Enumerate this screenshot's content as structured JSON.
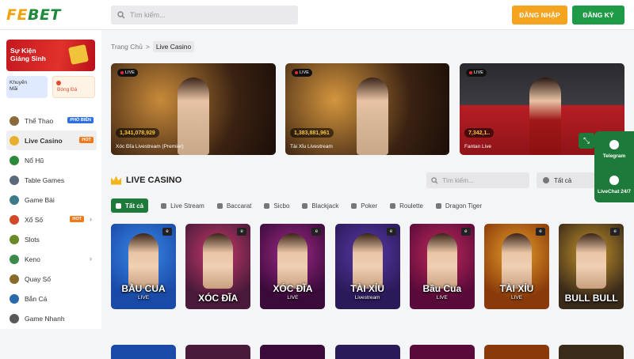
{
  "header": {
    "logo_fe": "FE",
    "logo_bet": "BET",
    "search_placeholder": "Tìm kiếm...",
    "login_label": "ĐĂNG NHẬP",
    "register_label": "ĐĂNG KÝ"
  },
  "sidebar": {
    "promo_event": "Sự Kiện\nGiáng Sinh",
    "promo_bonus": "Khuyến\nMãi",
    "promo_football": "Bóng Đá",
    "items": [
      {
        "label": "Thể Thao",
        "badge": "PHỔ BIẾN",
        "badge_color": "#2f6fe0",
        "icon_color": "#8a6a3a"
      },
      {
        "label": "Live Casino",
        "badge": "HOT",
        "badge_color": "#f07a1a",
        "icon_color": "#e8b02a"
      },
      {
        "label": "Nổ Hũ",
        "badge": "",
        "icon_color": "#2a8a3a"
      },
      {
        "label": "Table Games",
        "badge": "",
        "icon_color": "#5a6a7a"
      },
      {
        "label": "Game Bài",
        "badge": "",
        "icon_color": "#3a7a8a"
      },
      {
        "label": "Xổ Số",
        "badge": "HOT",
        "badge_color": "#f07a1a",
        "icon_color": "#d04a2a",
        "chevron": "›"
      },
      {
        "label": "Slots",
        "badge": "",
        "icon_color": "#6a8a2a"
      },
      {
        "label": "Keno",
        "badge": "",
        "icon_color": "#3a8a4a",
        "chevron": "›"
      },
      {
        "label": "Quay Số",
        "badge": "",
        "icon_color": "#8a6a2a"
      },
      {
        "label": "Bắn Cá",
        "badge": "",
        "icon_color": "#2a6aaa"
      },
      {
        "label": "Game Nhanh",
        "badge": "",
        "icon_color": "#5a5a5a"
      }
    ]
  },
  "breadcrumb": {
    "home": "Trang Chủ",
    "separator": ">",
    "current": "Live Casino"
  },
  "featured": [
    {
      "title": "Xóc Đĩa Livestream (Premier)",
      "amount": "1,341,078,929",
      "live": "LIVE"
    },
    {
      "title": "Tài Xỉu Livestream",
      "amount": "1,383,881,961",
      "live": "LIVE"
    },
    {
      "title": "Fantan Live",
      "amount": "7,342,1..",
      "live": "LIVE"
    }
  ],
  "section": {
    "title": "LIVE CASINO",
    "search_placeholder": "Tìm kiếm...",
    "select_value": "Tất cả"
  },
  "filters": [
    "Tất cả",
    "Live Stream",
    "Baccarat",
    "Sicbo",
    "Blackjack",
    "Poker",
    "Roulette",
    "Dragon Tiger"
  ],
  "games": [
    {
      "title": "BẦU CUA",
      "sub": "LIVE",
      "bg": "#1a4aa8",
      "accent": "#3a8ae8"
    },
    {
      "title": "XÓC ĐĨA",
      "sub": "",
      "bg": "#4a1a3a",
      "accent": "#c83a6a"
    },
    {
      "title": "XÓC ĐĨA",
      "sub": "LIVE",
      "bg": "#3a0a3a",
      "accent": "#a02a8a"
    },
    {
      "title": "TÀI XỈU",
      "sub": "Livestream",
      "bg": "#2a1a5a",
      "accent": "#5a3aa8"
    },
    {
      "title": "Bầu Cua",
      "sub": "LIVE",
      "bg": "#5a0a3a",
      "accent": "#c02a5a"
    },
    {
      "title": "TÀI XỈU",
      "sub": "LIVE",
      "bg": "#8a3a0a",
      "accent": "#e8a02a"
    },
    {
      "title": "BULL BULL",
      "sub": "",
      "bg": "#3a2a1a",
      "accent": "#c8962a"
    }
  ],
  "float_panel": {
    "telegram": "Telegram",
    "livechat": "LiveChat 24/7"
  }
}
